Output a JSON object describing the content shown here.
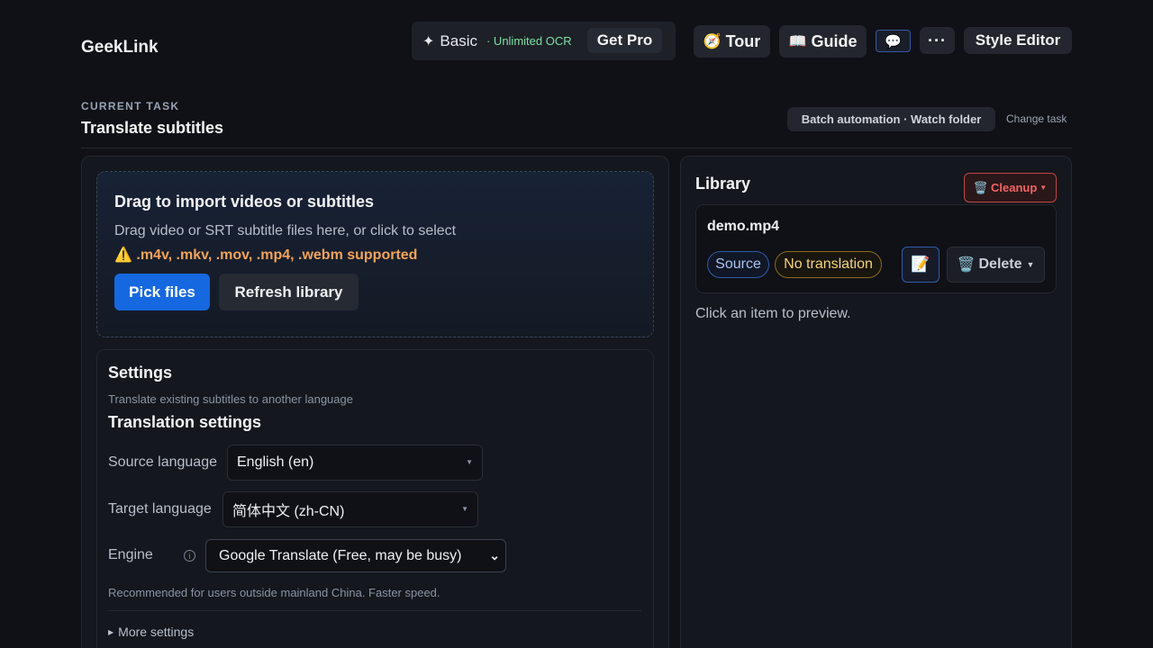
{
  "header": {
    "brand": "GeekLink",
    "plan": {
      "star": "✦",
      "name": "Basic",
      "tag": "· Unlimited OCR",
      "upgrade_label": "Get Pro"
    },
    "tour": {
      "icon": "🧭",
      "label": "Tour"
    },
    "guide": {
      "icon": "📖",
      "label": "Guide"
    },
    "chat_icon": "💬",
    "more_icon": "···",
    "style_editor": "Style Editor"
  },
  "task": {
    "label": "CURRENT TASK",
    "title": "Translate subtitles",
    "batch_chip": "Batch automation · Watch folder",
    "change_link": "Change task"
  },
  "import": {
    "title": "Drag to import videos or subtitles",
    "description": "Drag video or SRT subtitle files here, or click to select",
    "warning_icon": "⚠️",
    "supported": ".m4v, .mkv, .mov, .mp4, .webm supported",
    "pick_label": "Pick files",
    "refresh_label": "Refresh library"
  },
  "settings": {
    "title": "Settings",
    "description": "Translate existing subtitles to another language",
    "section_title": "Translation settings",
    "source_label": "Source language",
    "source_value": "English (en)",
    "target_label": "Target language",
    "target_value": "简体中文 (zh-CN)",
    "engine_label": "Engine",
    "engine_info_icon": "i",
    "engine_value": "Google Translate (Free, may be busy)",
    "engine_note": "Recommended for users outside mainland China. Faster speed.",
    "more_label": "More settings"
  },
  "library": {
    "title": "Library",
    "cleanup_icon": "🗑️",
    "cleanup_label": "Cleanup",
    "items": [
      {
        "name": "demo.mp4",
        "source_badge": "Source",
        "translation_badge": "No translation",
        "edit_icon": "📝",
        "delete_icon": "🗑️",
        "delete_label": "Delete"
      }
    ],
    "preview_hint": "Click an item to preview."
  },
  "colors": {
    "background": "#0f1116",
    "primary": "#1668e0",
    "warning": "#f4a35a",
    "danger": "#f26464",
    "success_tag": "#7ee0a4"
  }
}
